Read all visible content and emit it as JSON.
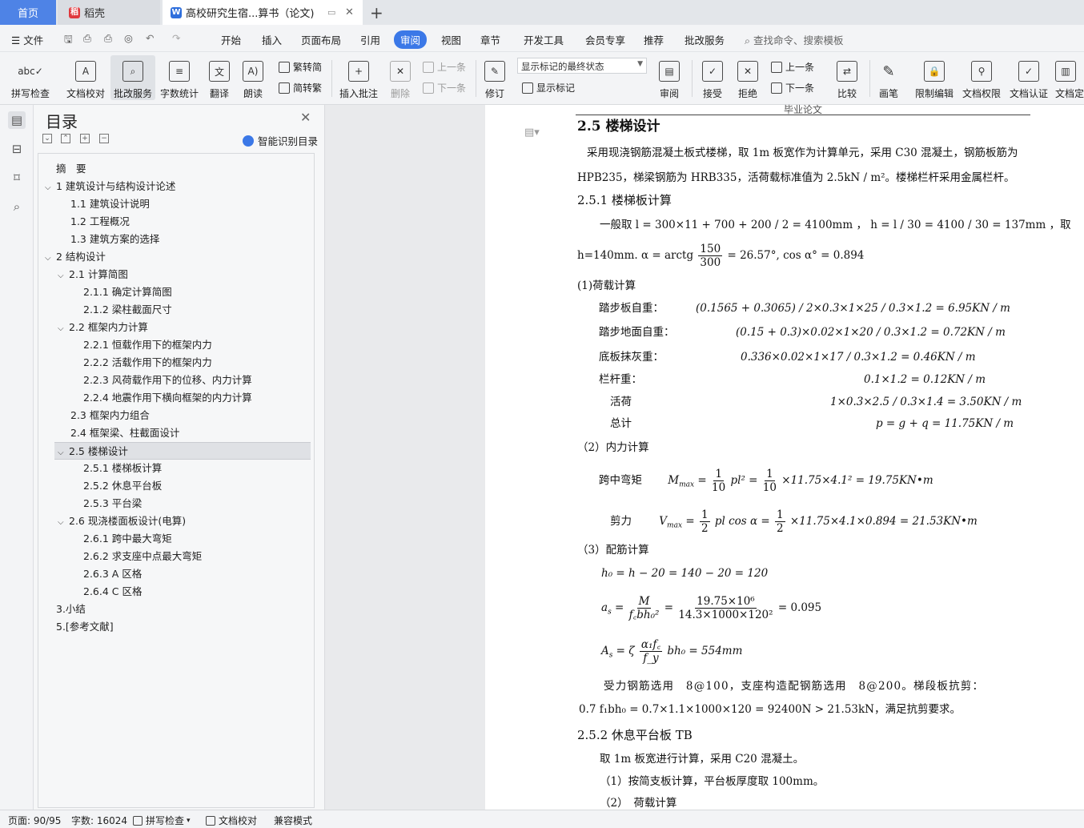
{
  "tabs": {
    "home": "首页",
    "daoke": "稻壳",
    "doc": "高校研究生宿...算书（论文)",
    "add": "+"
  },
  "menu": {
    "file": "文件",
    "items": [
      "开始",
      "插入",
      "页面布局",
      "引用",
      "审阅",
      "视图",
      "章节",
      "开发工具",
      "会员专享",
      "推荐",
      "批改服务"
    ],
    "search": "查找命令、搜索模板"
  },
  "ribbon": {
    "spell": "拼写检查",
    "proof": "文档校对",
    "batch": "批改服务",
    "count": "字数统计",
    "translate": "翻译",
    "read": "朗读",
    "to_trad": "繁转简",
    "to_simp": "简转繁",
    "add_comment": "插入批注",
    "delete": "删除",
    "prev": "上一条",
    "next": "下一条",
    "revise": "修订",
    "mark_state": "显示标记的最终状态",
    "show_marks": "显示标记",
    "review": "审阅",
    "accept": "接受",
    "reject": "拒绝",
    "prev2": "上一条",
    "next2": "下一条",
    "compare": "比较",
    "pen": "画笔",
    "restrict": "限制编辑",
    "perm": "文档权限",
    "auth": "文档认证",
    "final": "文档定"
  },
  "toc": {
    "title": "目录",
    "smart": "智能识别目录",
    "items": [
      {
        "text": "摘　要",
        "level": 0,
        "caret": ""
      },
      {
        "text": "1 建筑设计与结构设计论述",
        "level": 0,
        "caret": "v"
      },
      {
        "text": "1.1 建筑设计说明",
        "level": 1,
        "caret": ""
      },
      {
        "text": "1.2 工程概况",
        "level": 1,
        "caret": ""
      },
      {
        "text": "1.3 建筑方案的选择",
        "level": 1,
        "caret": ""
      },
      {
        "text": "2 结构设计",
        "level": 0,
        "caret": "v"
      },
      {
        "text": "2.1 计算简图",
        "level": 1,
        "caret": "v"
      },
      {
        "text": "2.1.1 确定计算简图",
        "level": 2,
        "caret": ""
      },
      {
        "text": "2.1.2 梁柱截面尺寸",
        "level": 2,
        "caret": ""
      },
      {
        "text": "2.2 框架内力计算",
        "level": 1,
        "caret": "v"
      },
      {
        "text": "2.2.1 恒载作用下的框架内力",
        "level": 2,
        "caret": ""
      },
      {
        "text": "2.2.2 活载作用下的框架内力",
        "level": 2,
        "caret": ""
      },
      {
        "text": "2.2.3 风荷载作用下的位移、内力计算",
        "level": 2,
        "caret": ""
      },
      {
        "text": "2.2.4 地震作用下横向框架的内力计算",
        "level": 2,
        "caret": ""
      },
      {
        "text": "2.3 框架内力组合",
        "level": 1,
        "caret": ""
      },
      {
        "text": "2.4 框架梁、柱截面设计",
        "level": 1,
        "caret": ""
      },
      {
        "text": "2.5 楼梯设计",
        "level": 1,
        "caret": "v",
        "selected": true
      },
      {
        "text": "2.5.1 楼梯板计算",
        "level": 2,
        "caret": ""
      },
      {
        "text": "2.5.2 休息平台板",
        "level": 2,
        "caret": ""
      },
      {
        "text": "2.5.3 平台梁",
        "level": 2,
        "caret": ""
      },
      {
        "text": "2.6 现浇楼面板设计(电算)",
        "level": 1,
        "caret": "v"
      },
      {
        "text": "2.6.1 跨中最大弯矩",
        "level": 2,
        "caret": ""
      },
      {
        "text": "2.6.2 求支座中点最大弯矩",
        "level": 2,
        "caret": ""
      },
      {
        "text": "2.6.3 A 区格",
        "level": 2,
        "caret": ""
      },
      {
        "text": "2.6.4 C 区格",
        "level": 2,
        "caret": ""
      },
      {
        "text": "3.小结",
        "level": 0,
        "caret": ""
      },
      {
        "text": "5.[参考文献]",
        "level": 0,
        "caret": ""
      }
    ]
  },
  "doc": {
    "header": "毕业论文",
    "h25": "2.5 楼梯设计",
    "p1a": "采用现浇钢筋混凝土板式楼梯，取 1m 板宽作为计算单元，采用 C30 混凝土，钢筋板筋为",
    "p1b": "HPB235，梯梁钢筋为 HRB335，活荷载标准值为 2.5kN / m²。楼梯栏杆采用金属栏杆。",
    "h251": "2.5.1 楼梯板计算",
    "p2": "一般取 l = 300×11 + 700 + 200 / 2 = 4100mm ， h = l / 30 = 4100 / 30 = 137mm ，取",
    "p3a": "h=140mm.  α = arctg",
    "p3n": "150",
    "p3d": "300",
    "p3b": "= 26.57°, cos α° = 0.894",
    "load_title": "(1)荷载计算",
    "loads": [
      {
        "label": "踏步板自重：",
        "eq": "(0.1565 + 0.3065) / 2×0.3×1×25 / 0.3×1.2 = 6.95KN / m"
      },
      {
        "label": "踏步地面自重：",
        "eq": "(0.15 + 0.3)×0.02×1×20 / 0.3×1.2 = 0.72KN / m"
      },
      {
        "label": "底板抹灰重：",
        "eq": "0.336×0.02×1×17 / 0.3×1.2 = 0.46KN / m"
      },
      {
        "label": "栏杆重：",
        "eq": "0.1×1.2 = 0.12KN / m"
      },
      {
        "label": "活荷",
        "eq": "1×0.3×2.5 / 0.3×1.4 = 3.50KN / m"
      },
      {
        "label": "总计",
        "eq": "p = g + q = 11.75KN / m"
      }
    ],
    "force_title": "（2）内力计算",
    "mlabel": "跨中弯矩",
    "meq_a": "M",
    "meq_sub": "max",
    "meq_b": "=",
    "meq_n1": "1",
    "meq_d1": "10",
    "meq_c": "pl² =",
    "meq_n2": "1",
    "meq_d2": "10",
    "meq_e": "×11.75×4.1² = 19.75KN•m",
    "vlabel": "剪力",
    "veq_a": "V",
    "veq_sub": "max",
    "veq_b": "=",
    "veq_n1": "1",
    "veq_d1": "2",
    "veq_c": "pl cos α =",
    "veq_n2": "1",
    "veq_d2": "2",
    "veq_e": "×11.75×4.1×0.894 = 21.53KN•m",
    "rebar_title": "（3）配筋计算",
    "h0": "h₀ = h − 20 = 140 − 20 = 120",
    "as_a": "a",
    "as_sub": "s",
    "as_b": "=",
    "as_n1": "M",
    "as_d1": "f꜀bh₀²",
    "as_n2": "19.75×10⁶",
    "as_d2": "14.3×1000×120²",
    "as_c": "= 0.095",
    "As_a": "A",
    "As_sub": "s",
    "As_b": "= ζ",
    "As_n": "α₁f꜀",
    "As_d": "f_y",
    "As_c": "bh₀ = 554mm",
    "p4a": "受力钢筋选用　8@100，支座构造配钢筋选用　8@200。梯段板抗剪：",
    "p4b": "0.7 f₁bh₀ = 0.7×1.1×1000×120 = 92400N > 21.53kN，满足抗剪要求。",
    "h252": "2.5.2 休息平台板 TB",
    "p5": "取 1m 板宽进行计算，采用 C20 混凝土。",
    "p6": "（1）按简支板计算，平台板厚度取 100mm。",
    "p7": "（2）　荷载计算"
  },
  "status": {
    "page": "页面: 90/95",
    "words": "字数: 16024",
    "spell": "拼写检查",
    "proof": "文档校对",
    "compat": "兼容模式"
  }
}
